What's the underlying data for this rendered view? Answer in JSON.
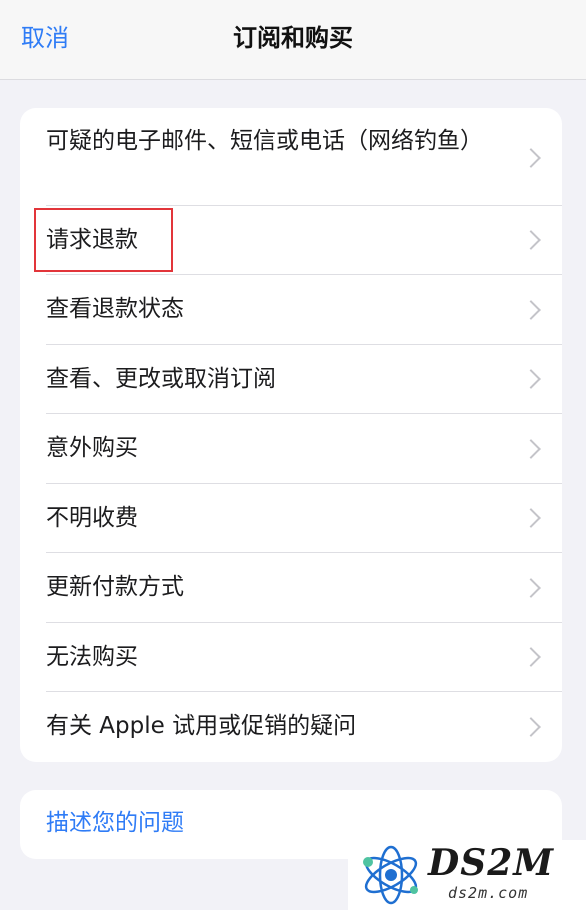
{
  "navbar": {
    "cancel_label": "取消",
    "title": "订阅和购买"
  },
  "menu": {
    "items": [
      {
        "label": "可疑的电子邮件、短信或电话（网络钓鱼）",
        "highlighted": false
      },
      {
        "label": "请求退款",
        "highlighted": true
      },
      {
        "label": "查看退款状态",
        "highlighted": false
      },
      {
        "label": "查看、更改或取消订阅",
        "highlighted": false
      },
      {
        "label": "意外购买",
        "highlighted": false
      },
      {
        "label": "不明收费",
        "highlighted": false
      },
      {
        "label": "更新付款方式",
        "highlighted": false
      },
      {
        "label": "无法购买",
        "highlighted": false
      },
      {
        "label": "有关 Apple 试用或促销的疑问",
        "highlighted": false
      }
    ]
  },
  "describe": {
    "label": "描述您的问题"
  },
  "watermark": {
    "brand": "DS2M",
    "site": "ds2m.com"
  },
  "colors": {
    "accent": "#2f7cf6",
    "highlight_border": "#e2353a",
    "background": "#f2f2f7"
  }
}
